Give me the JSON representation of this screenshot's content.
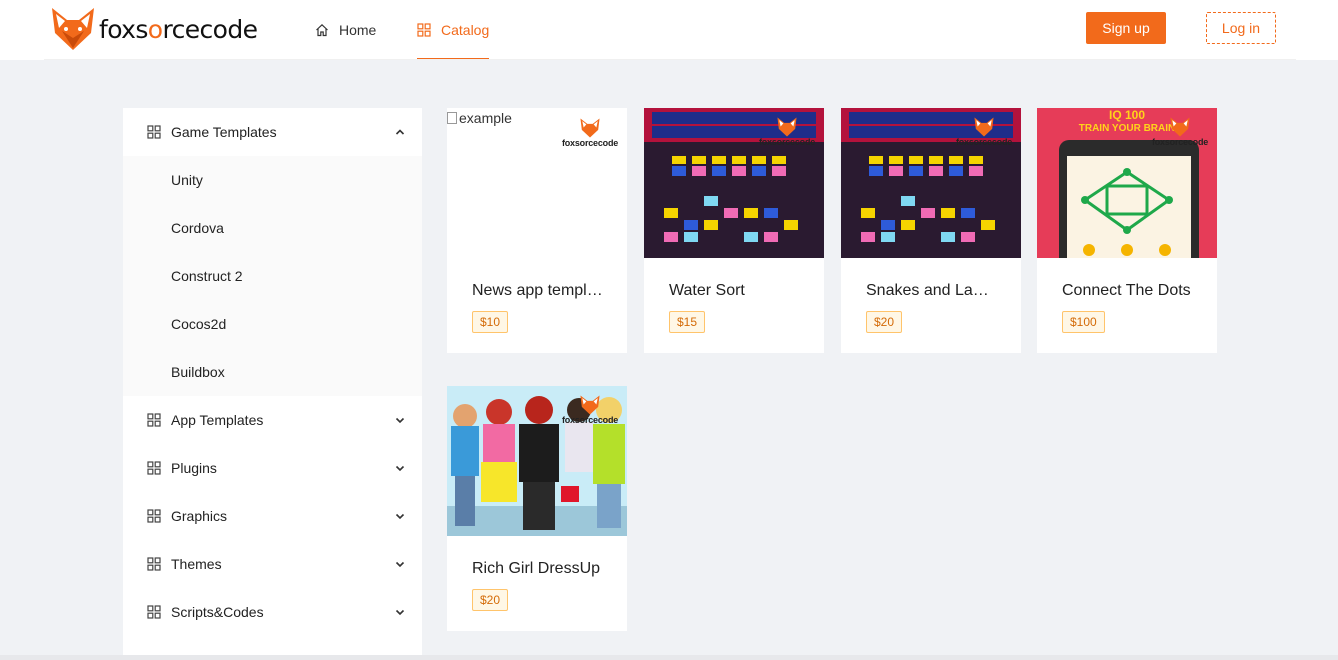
{
  "brand": {
    "name_part1": "foxs",
    "name_o": "o",
    "name_part2": "rcecode",
    "accent": "#f26a1b"
  },
  "nav": {
    "home": {
      "label": "Home",
      "icon": "home-icon"
    },
    "catalog": {
      "label": "Catalog",
      "icon": "appstore-icon",
      "active": true
    }
  },
  "auth": {
    "signup_label": "Sign up",
    "login_label": "Log in"
  },
  "sidebar": {
    "items": [
      {
        "label": "Game Templates",
        "expanded": true,
        "children": [
          "Unity",
          "Cordova",
          "Construct 2",
          "Cocos2d",
          "Buildbox"
        ]
      },
      {
        "label": "App Templates",
        "expanded": false
      },
      {
        "label": "Plugins",
        "expanded": false
      },
      {
        "label": "Graphics",
        "expanded": false
      },
      {
        "label": "Themes",
        "expanded": false
      },
      {
        "label": "Scripts&Codes",
        "expanded": false
      }
    ]
  },
  "watermark": "foxsorcecode",
  "products": [
    {
      "title": "News app templ…",
      "price": "$10",
      "image_alt": "example"
    },
    {
      "title": "Water Sort",
      "price": "$15"
    },
    {
      "title": "Snakes and La…",
      "price": "$20"
    },
    {
      "title": "Connect The Dots",
      "price": "$100",
      "image_banner_1": "IQ 100",
      "image_banner_2": "TRAIN YOUR BRAIN"
    },
    {
      "title": "Rich Girl DressUp",
      "price": "$20"
    }
  ]
}
